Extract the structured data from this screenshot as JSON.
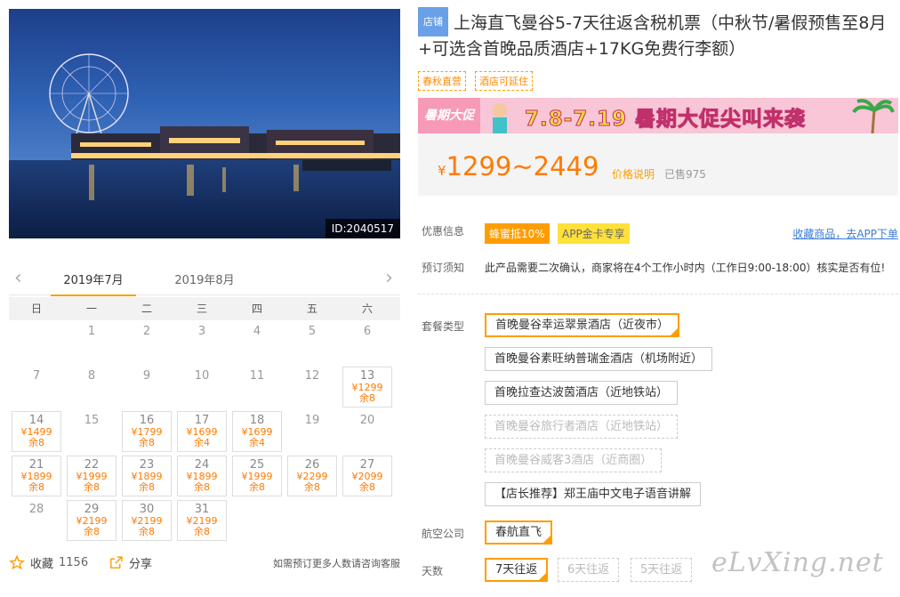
{
  "hero": {
    "image_id": "ID:2040517"
  },
  "calendar": {
    "months": [
      "2019年7月",
      "2019年8月"
    ],
    "weekdays": [
      "日",
      "一",
      "二",
      "三",
      "四",
      "五",
      "六"
    ],
    "days": [
      {
        "day": ""
      },
      {
        "day": "1"
      },
      {
        "day": "2"
      },
      {
        "day": "3"
      },
      {
        "day": "4"
      },
      {
        "day": "5"
      },
      {
        "day": "6"
      },
      {
        "day": "7"
      },
      {
        "day": "8"
      },
      {
        "day": "9"
      },
      {
        "day": "10"
      },
      {
        "day": "11"
      },
      {
        "day": "12"
      },
      {
        "day": "13",
        "price": "¥1299",
        "remain": "余8"
      },
      {
        "day": "14",
        "price": "¥1499",
        "remain": "余8"
      },
      {
        "day": "15"
      },
      {
        "day": "16",
        "price": "¥1799",
        "remain": "余8"
      },
      {
        "day": "17",
        "price": "¥1699",
        "remain": "余4"
      },
      {
        "day": "18",
        "price": "¥1699",
        "remain": "余4"
      },
      {
        "day": "19"
      },
      {
        "day": "20"
      },
      {
        "day": "21",
        "price": "¥1899",
        "remain": "余8"
      },
      {
        "day": "22",
        "price": "¥1999",
        "remain": "余8"
      },
      {
        "day": "23",
        "price": "¥1899",
        "remain": "余8"
      },
      {
        "day": "24",
        "price": "¥1899",
        "remain": "余8"
      },
      {
        "day": "25",
        "price": "¥1999",
        "remain": "余8"
      },
      {
        "day": "26",
        "price": "¥2299",
        "remain": "余8"
      },
      {
        "day": "27",
        "price": "¥2099",
        "remain": "余8"
      },
      {
        "day": "28"
      },
      {
        "day": "29",
        "price": "¥2199",
        "remain": "余8"
      },
      {
        "day": "30",
        "price": "¥2199",
        "remain": "余8"
      },
      {
        "day": "31",
        "price": "¥2199",
        "remain": "余8"
      }
    ]
  },
  "footer": {
    "fav_label": "收藏",
    "fav_count": "1156",
    "share_label": "分享",
    "contact_text": "如需预订更多人数请咨询客服"
  },
  "product": {
    "shop_badge": "店铺",
    "title": "上海直飞曼谷5-7天往返含税机票（中秋节/暑假预售至8月+可选含首晚品质酒店+17KG免费行李额）",
    "tags": [
      "春秋直营",
      "酒店可延住"
    ]
  },
  "banner": {
    "left_text": "暑期大促",
    "text": "7.8-7.19 暑期大促尖叫来袭"
  },
  "price": {
    "currency": "¥",
    "range": "1299~2449",
    "note": "价格说明",
    "sold": "已售975"
  },
  "discount": {
    "label": "优惠信息",
    "chip_honey": "蜂蜜抵10%",
    "chip_app": "APP金卡专享",
    "app_link": "收藏商品，去APP下单"
  },
  "notice": {
    "label": "预订须知",
    "text": "此产品需要二次确认，商家将在4个工作小时内（工作日9:00-18:00）核实是否有位!"
  },
  "package": {
    "label": "套餐类型",
    "options": [
      {
        "text": "首晚曼谷幸运翠景酒店（近夜市）",
        "state": "selected"
      },
      {
        "text": "首晚曼谷素旺纳普瑞金酒店（机场附近）",
        "state": "normal"
      },
      {
        "text": "首晚拉查达波茵酒店（近地铁站）",
        "state": "normal"
      },
      {
        "text": "首晚曼谷旅行者酒店（近地铁站）",
        "state": "disabled"
      },
      {
        "text": "首晚曼谷威客3酒店（近商圈）",
        "state": "disabled"
      },
      {
        "text": "【店长推荐】郑王庙中文电子语音讲解",
        "state": "normal"
      }
    ]
  },
  "airline": {
    "label": "航空公司",
    "option": "春航直飞"
  },
  "days": {
    "label": "天数",
    "options": [
      {
        "text": "7天往返",
        "state": "selected"
      },
      {
        "text": "6天往返",
        "state": "disabled"
      },
      {
        "text": "5天往返",
        "state": "disabled"
      }
    ]
  },
  "watermark": "eLvXing.net",
  "colors": {
    "accent": "#ff9d00",
    "price": "#ff7a00",
    "link": "#3a7bd5",
    "shop_badge": "#6aa0e8"
  }
}
